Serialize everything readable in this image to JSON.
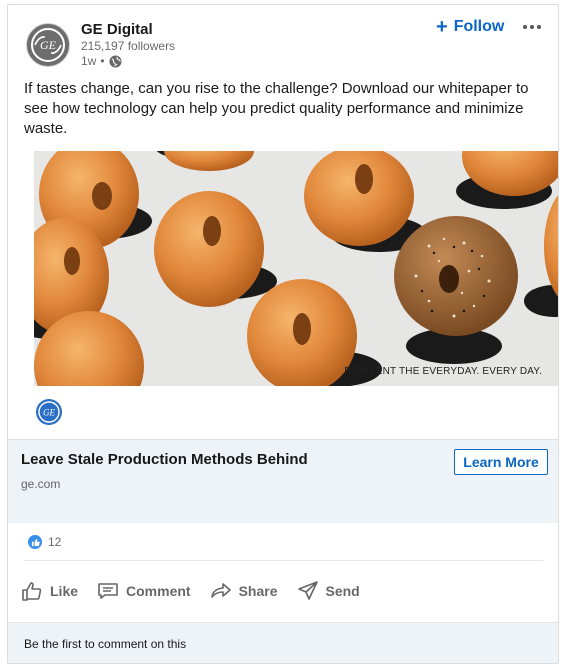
{
  "post": {
    "company_name": "GE Digital",
    "company_logo_text": "GE",
    "followers": "215,197 followers",
    "time_ago": "1w",
    "follow_label": "Follow",
    "text": "If tastes change, can you rise to the challenge?  Download our whitepaper to see how technology can help you predict quality performance and minimize waste."
  },
  "ad": {
    "tagline": "REINVENT THE EVERYDAY. EVERY DAY.",
    "link_title": "Leave Stale Production Methods Behind",
    "link_domain": "ge.com",
    "cta_label": "Learn More"
  },
  "social": {
    "reaction_count": "12"
  },
  "actions": {
    "like": "Like",
    "comment": "Comment",
    "share": "Share",
    "send": "Send"
  },
  "comments": {
    "prompt": "Be the first to comment on this"
  },
  "colors": {
    "accent": "#0a66c2",
    "link_bg": "#eef3f8",
    "bagel": "#e8943f"
  }
}
